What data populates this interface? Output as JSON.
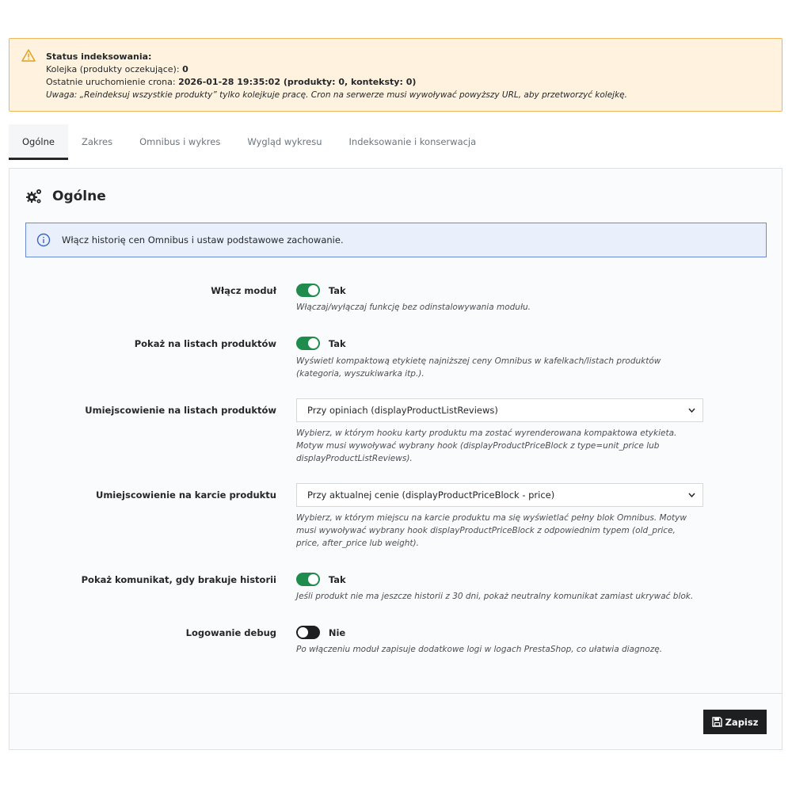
{
  "status": {
    "title": "Status indeksowania:",
    "queue_label": "Kolejka (produkty oczekujące):",
    "queue_value": "0",
    "cron_label": "Ostatnie uruchomienie crona:",
    "cron_value": "2026-01-28 19:35:02 (produkty: 0, konteksty: 0)",
    "note": "Uwaga: „Reindeksuj wszystkie produkty” tylko kolejkuje pracę. Cron na serwerze musi wywoływać powyższy URL, aby przetworzyć kolejkę.",
    "icon": "warning-icon",
    "color": "#f0b45a"
  },
  "tabs": [
    "Ogólne",
    "Zakres",
    "Omnibus i wykres",
    "Wygląd wykresu",
    "Indeksowanie i konserwacja"
  ],
  "active_tab": "Ogólne",
  "panel": {
    "title": "Ogólne",
    "icon": "cogs-icon",
    "info": "Włącz historię cen Omnibus i ustaw podstawowe zachowanie."
  },
  "fields": {
    "enable_module": {
      "label": "Włącz moduł",
      "state": "Tak",
      "enabled": true,
      "help": "Włączaj/wyłączaj funkcję bez odinstalowywania modułu."
    },
    "show_on_lists": {
      "label": "Pokaż na listach produktów",
      "state": "Tak",
      "enabled": true,
      "help": "Wyświetl kompaktową etykietę najniższej ceny Omnibus w kafelkach/listach produktów (kategoria, wyszukiwarka itp.)."
    },
    "list_position": {
      "label": "Umiejscowienie na listach produktów",
      "value": "Przy opiniach (displayProductListReviews)",
      "help": "Wybierz, w którym hooku karty produktu ma zostać wyrenderowana kompaktowa etykieta. Motyw musi wywoływać wybrany hook (displayProductPriceBlock z type=unit_price lub displayProductListReviews)."
    },
    "product_position": {
      "label": "Umiejscowienie na karcie produktu",
      "value": "Przy aktualnej cenie (displayProductPriceBlock - price)",
      "help": "Wybierz, w którym miejscu na karcie produktu ma się wyświetlać pełny blok Omnibus. Motyw musi wywoływać wybrany hook displayProductPriceBlock z odpowiednim typem (old_price, price, after_price lub weight)."
    },
    "missing_history": {
      "label": "Pokaż komunikat, gdy brakuje historii",
      "state": "Tak",
      "enabled": true,
      "help": "Jeśli produkt nie ma jeszcze historii z 30 dni, pokaż neutralny komunikat zamiast ukrywać blok."
    },
    "debug": {
      "label": "Logowanie debug",
      "state": "Nie",
      "enabled": false,
      "help": "Po włączeniu moduł zapisuje dodatkowe logi w logach PrestaShop, co ułatwia diagnozę."
    }
  },
  "save_label": "Zapisz",
  "colors": {
    "toggle_on": "#1f8b4c",
    "toggle_off": "#1e1f21",
    "info_border": "#6b8ad6",
    "button": "#1e1f21"
  }
}
